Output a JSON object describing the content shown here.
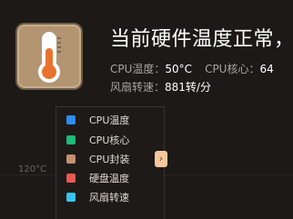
{
  "header": {
    "headline": "当前硬件温度正常，"
  },
  "stats": {
    "cpu_temp_label": "CPU温度：",
    "cpu_temp_value": "50°C",
    "cpu_core_label": "CPU核心：",
    "cpu_core_value": "64",
    "fan_label": "风扇转速：",
    "fan_value": "881转/分"
  },
  "legend": {
    "items": [
      {
        "label": "CPU温度",
        "color": "#2f8bf0"
      },
      {
        "label": "CPU核心",
        "color": "#1fba78"
      },
      {
        "label": "CPU封装",
        "color": "#c39070"
      },
      {
        "label": "硬盘温度",
        "color": "#e85a50"
      },
      {
        "label": "风扇转速",
        "color": "#38c4ec"
      }
    ],
    "toggle_glyph": "›"
  },
  "chart": {
    "y_tick": "120°C"
  },
  "icons": {
    "app": "thermometer-icon",
    "toggle": "chevron-right-icon"
  }
}
